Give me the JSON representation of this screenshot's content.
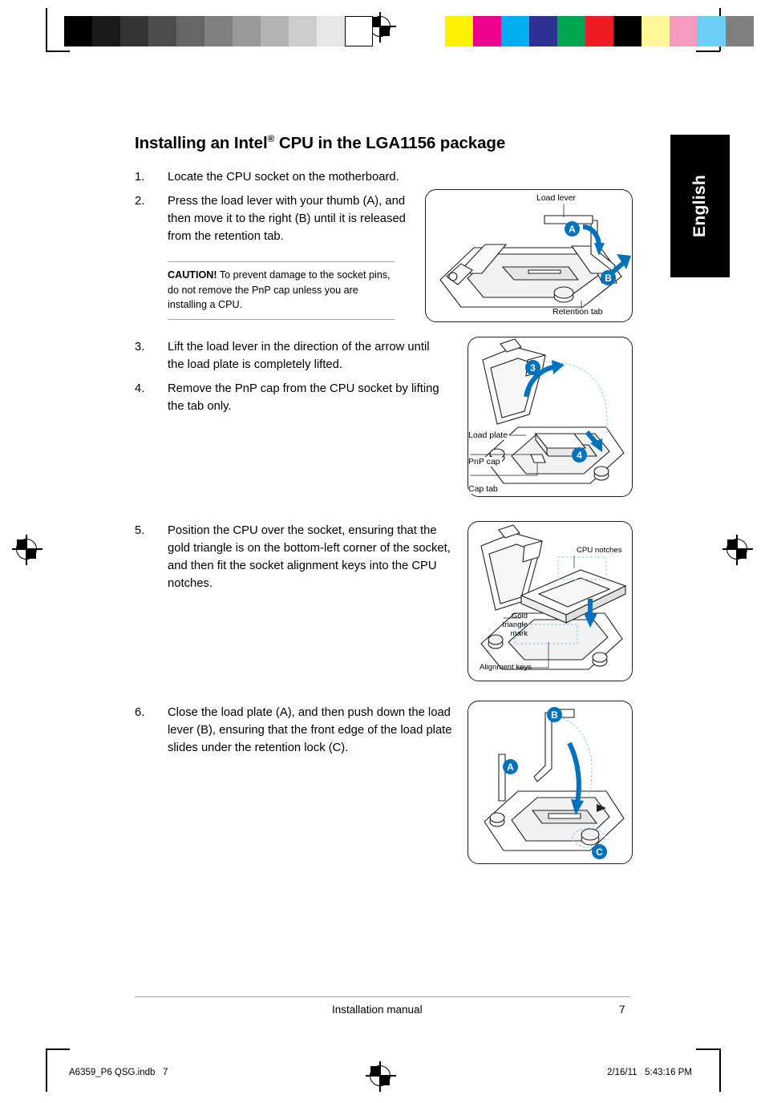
{
  "document": {
    "sidebar_tab": "English",
    "title_part1": "Installing an Intel",
    "title_sup": "®",
    "title_part2": " CPU in the LGA1156 package",
    "steps": [
      {
        "num": "1.",
        "text": "Locate the CPU socket on the motherboard."
      },
      {
        "num": "2.",
        "text": "Press the load lever with your thumb (A), and then move it to the right (B) until it is released from the retention tab."
      },
      {
        "num": "3.",
        "text": "Lift the load lever in the direction of the arrow until the load plate is completely lifted."
      },
      {
        "num": "4.",
        "text": "Remove the PnP cap from the CPU socket by lifting the tab only."
      },
      {
        "num": "5.",
        "text": "Position the CPU over the socket, ensuring that the gold triangle is on the bottom-left corner of the socket, and then fit the socket alignment keys into the CPU notches."
      },
      {
        "num": "6.",
        "text": "Close the load plate (A), and then push down the load lever (B), ensuring that the front edge of the load plate slides under the retention lock (C)."
      }
    ],
    "caution": {
      "label": "CAUTION!",
      "text": " To prevent damage to the socket pins, do not remove the PnP cap unless you are installing a CPU."
    },
    "figures": {
      "fig1": {
        "label_load_lever": "Load lever",
        "label_retention_tab": "Retention tab",
        "badge_a": "A",
        "badge_b": "B"
      },
      "fig2": {
        "badge_3": "3",
        "badge_4": "4",
        "label_load_plate": "Load plate",
        "label_pnp_cap": "PnP cap",
        "label_cap_tab": "Cap tab"
      },
      "fig3": {
        "label_cpu_notches": "CPU notches",
        "label_gold_triangle": "Gold\ntriangle\nmark",
        "label_alignment_keys": "Alignment keys"
      },
      "fig4": {
        "badge_a": "A",
        "badge_b": "B",
        "badge_c": "C"
      }
    },
    "footer": {
      "center": "Installation manual",
      "page": "7"
    },
    "imprint": {
      "left": "A6359_P6 QSG.indb   7",
      "right": "2/16/11   5:43:16 PM"
    },
    "colorbars": {
      "grayscale": [
        "#000000",
        "#1a1a1a",
        "#333333",
        "#4d4d4d",
        "#666666",
        "#808080",
        "#999999",
        "#b3b3b3",
        "#cccccc",
        "#e6e6e6",
        "#ffffff"
      ],
      "process": [
        "#fff200",
        "#ec008c",
        "#00aeef",
        "#2e3192",
        "#00a651",
        "#ed1c24",
        "#000000",
        "#fff799",
        "#f49ac1",
        "#6dcff6",
        "#808080"
      ]
    }
  }
}
